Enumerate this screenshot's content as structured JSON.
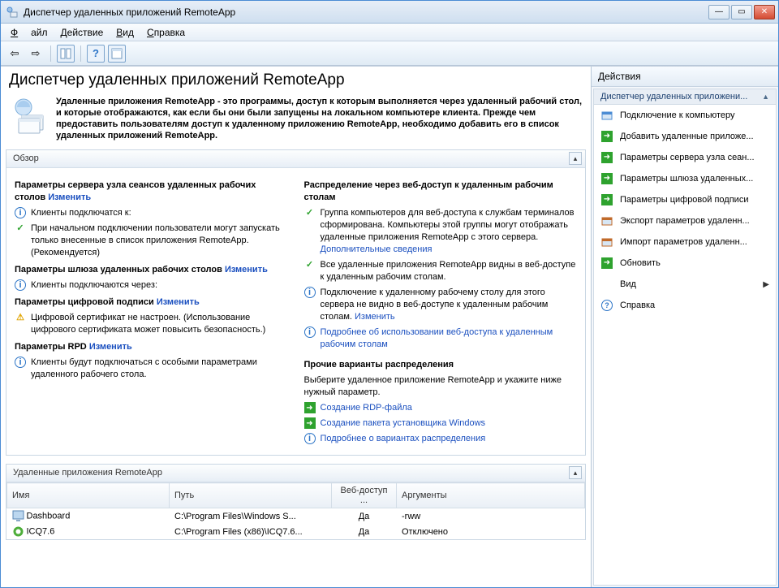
{
  "window": {
    "title": "Диспетчер удаленных приложений RemoteApp"
  },
  "menubar": {
    "file": "Файл",
    "action": "Действие",
    "view": "Вид",
    "help": "Справка"
  },
  "page": {
    "title": "Диспетчер удаленных приложений RemoteApp",
    "intro": "Удаленные приложения RemoteApp - это программы, доступ к которым выполняется через удаленный рабочий стол, и которые отображаются, как если бы они были запущены на локальном компьютере клиента. Прежде чем предоставить пользователям доступ к удаленному приложению RemoteApp, необходимо добавить его в список удаленных приложений RemoteApp."
  },
  "overview": {
    "heading": "Обзор",
    "left": {
      "h1": "Параметры сервера узла сеансов удаленных рабочих столов",
      "h1_change": "Изменить",
      "l1": "Клиенты подключатся к:",
      "l2": "При начальном подключении пользователи могут запускать только внесенные в список приложения RemoteApp. (Рекомендуется)",
      "h2": "Параметры шлюза удаленных рабочих столов",
      "h2_change": "Изменить",
      "l3": "Клиенты подключаются через:",
      "h3": "Параметры цифровой подписи",
      "h3_change": "Изменить",
      "l4": "Цифровой сертификат не настроен. (Использование цифрового сертификата может повысить безопасность.)",
      "h4": "Параметры RPD",
      "h4_change": "Изменить",
      "l5": "Клиенты будут подключаться с особыми параметрами удаленного рабочего стола."
    },
    "right": {
      "h1": "Распределение через веб-доступ к удаленным рабочим столам",
      "r1a": "Группа компьютеров для веб-доступа к службам терминалов сформирована. Компьютеры этой группы могут отображать удаленные приложения RemoteApp с этого сервера.",
      "r1b": "Дополнительные сведения",
      "r2": "Все удаленные приложения RemoteApp видны в веб-доступе к удаленным рабочим столам.",
      "r3a": "Подключение к удаленному рабочему столу для этого сервера не видно в веб-доступе к удаленным рабочим столам.",
      "r3b": "Изменить",
      "r4": "Подробнее об использовании веб-доступа к удаленным рабочим столам",
      "h2": "Прочие варианты распределения",
      "h2_sub": "Выберите удаленное приложение RemoteApp и укажите ниже нужный параметр.",
      "r5": "Создание RDP-файла",
      "r6": "Создание пакета установщика Windows",
      "r7": "Подробнее о вариантах распределения"
    }
  },
  "remoteapps": {
    "heading": "Удаленные приложения RemoteApp",
    "columns": {
      "name": "Имя",
      "path": "Путь",
      "web": "Веб-доступ ...",
      "args": "Аргументы"
    },
    "rows": [
      {
        "name": "Dashboard",
        "path": "C:\\Program Files\\Windows S...",
        "web": "Да",
        "args": "-rww"
      },
      {
        "name": "ICQ7.6",
        "path": "C:\\Program Files (x86)\\ICQ7.6...",
        "web": "Да",
        "args": "Отключено"
      }
    ]
  },
  "actions": {
    "heading": "Действия",
    "group": "Диспетчер удаленных приложени...",
    "items": [
      {
        "label": "Подключение к компьютеру",
        "icon": "computer-connect-icon",
        "color": "#4b8cd4"
      },
      {
        "label": "Добавить удаленные приложе...",
        "icon": "add-app-icon",
        "green": true
      },
      {
        "label": "Параметры сервера узла сеан...",
        "icon": "server-settings-icon",
        "green": true
      },
      {
        "label": "Параметры шлюза удаленных...",
        "icon": "gateway-settings-icon",
        "green": true
      },
      {
        "label": "Параметры цифровой подписи",
        "icon": "signature-settings-icon",
        "green": true
      },
      {
        "label": "Экспорт параметров удаленн...",
        "icon": "export-icon",
        "color": "#c06a2a"
      },
      {
        "label": "Импорт параметров удаленн...",
        "icon": "import-icon",
        "color": "#c06a2a"
      },
      {
        "label": "Обновить",
        "icon": "refresh-icon",
        "green": true
      },
      {
        "label": "Вид",
        "icon": "view-icon",
        "submenu": true
      },
      {
        "label": "Справка",
        "icon": "help-icon",
        "color": "#2b74c7"
      }
    ]
  }
}
